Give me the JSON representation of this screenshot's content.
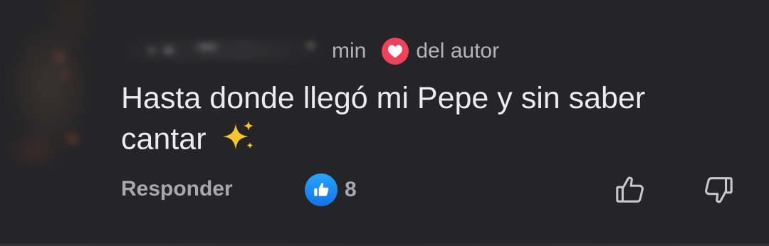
{
  "comment": {
    "time_label": "min",
    "author_badge_label": "del autor",
    "text_line1": "Hasta donde llegó mi Pepe y sin saber",
    "text_line2": "cantar",
    "emoji": "✨"
  },
  "actions": {
    "reply_label": "Responder",
    "like_count": "8"
  },
  "colors": {
    "background": "#252527",
    "heart_badge": "#f0425a",
    "like_badge": "#1877f2",
    "muted_text": "#a9a9ab"
  },
  "icons": {
    "heart": "heart-icon",
    "like": "like-thumb-icon",
    "thumb_up": "thumbs-up-icon",
    "thumb_down": "thumbs-down-icon"
  }
}
